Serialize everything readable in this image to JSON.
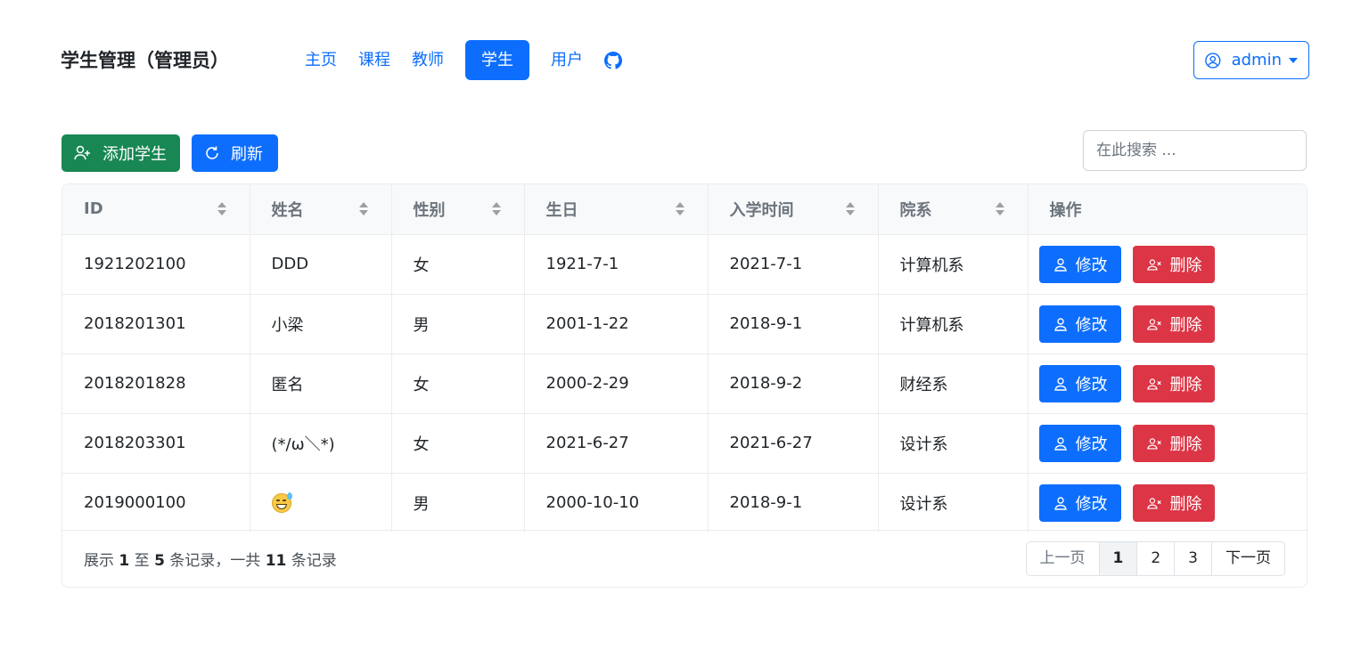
{
  "header": {
    "brand": "学生管理（管理员）",
    "nav": [
      {
        "label": "主页"
      },
      {
        "label": "课程"
      },
      {
        "label": "教师"
      },
      {
        "label": "学生",
        "active": true
      },
      {
        "label": "用户"
      }
    ],
    "github_icon": "github-icon",
    "user": {
      "name": "admin",
      "icon": "user-circle-icon"
    }
  },
  "toolbar": {
    "add_label": "添加学生",
    "refresh_label": "刷新",
    "search_placeholder": "在此搜索 ..."
  },
  "table": {
    "columns": [
      "ID",
      "姓名",
      "性别",
      "生日",
      "入学时间",
      "院系",
      "操作"
    ],
    "rows": [
      {
        "id": "1921202100",
        "name": "DDD",
        "gender": "女",
        "birthday": "1921-7-1",
        "enroll": "2021-7-1",
        "dept": "计算机系"
      },
      {
        "id": "2018201301",
        "name": "小梁",
        "gender": "男",
        "birthday": "2001-1-22",
        "enroll": "2018-9-1",
        "dept": "计算机系"
      },
      {
        "id": "2018201828",
        "name": "匿名",
        "gender": "女",
        "birthday": "2000-2-29",
        "enroll": "2018-9-2",
        "dept": "财经系"
      },
      {
        "id": "2018203301",
        "name": "(*/ω＼*)",
        "gender": "女",
        "birthday": "2021-6-27",
        "enroll": "2021-6-27",
        "dept": "设计系"
      },
      {
        "id": "2019000100",
        "name": "",
        "name_icon": "grinning-sweat-emoji",
        "gender": "男",
        "birthday": "2000-10-10",
        "enroll": "2018-9-1",
        "dept": "设计系"
      }
    ],
    "edit_label": "修改",
    "delete_label": "删除"
  },
  "footer": {
    "info_prefix": "展示",
    "from": "1",
    "to_word": "至",
    "to": "5",
    "mid": "条记录，一共",
    "total": "11",
    "suffix": "条记录",
    "pagination": {
      "prev": "上一页",
      "pages": [
        "1",
        "2",
        "3"
      ],
      "current": "1",
      "next": "下一页"
    }
  },
  "colors": {
    "primary": "#0d6efd",
    "success": "#198754",
    "danger": "#dc3545"
  }
}
